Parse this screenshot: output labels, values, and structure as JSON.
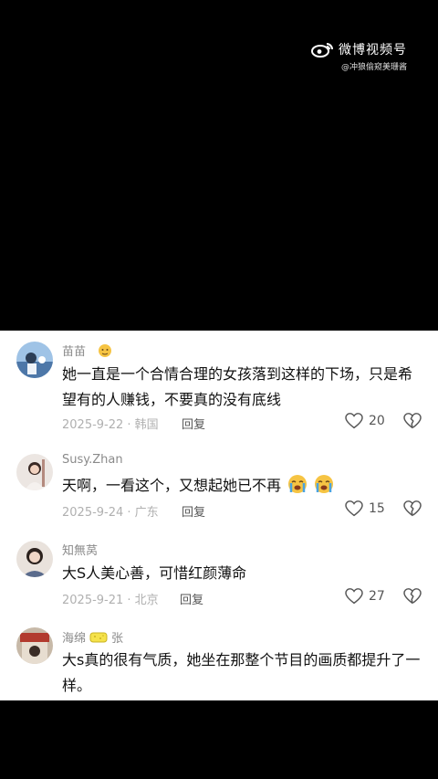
{
  "watermark": {
    "title": "微博视频号",
    "handle": "@冲狼偷窥美珊酱"
  },
  "comments": [
    {
      "user": "苗苗",
      "text": "她一直是一个合情合理的女孩落到这样的下场，只是希望有的人赚钱，不要真的没有底线",
      "date": "2025-9-22 · 韩国",
      "reply": "回复",
      "likes": "20"
    },
    {
      "user": "Susy.Zhan",
      "text": "天啊，一看这个，又想起她已不再",
      "date": "2025-9-24 · 广东",
      "reply": "回复",
      "likes": "15"
    },
    {
      "user": "知無莴",
      "text": "大S人美心善，可惜红颜薄命",
      "date": "2025-9-21 · 北京",
      "reply": "回复",
      "likes": "27"
    },
    {
      "user_a": "海绵",
      "user_b": "张",
      "text": "大s真的很有气质，她坐在那整个节目的画质都提升了一样。"
    }
  ],
  "icons": {
    "like": "heart-icon",
    "dislike": "broken-heart-icon",
    "crying_emoji": "crying-face-icon",
    "sponge_emoji": "sponge-icon"
  }
}
